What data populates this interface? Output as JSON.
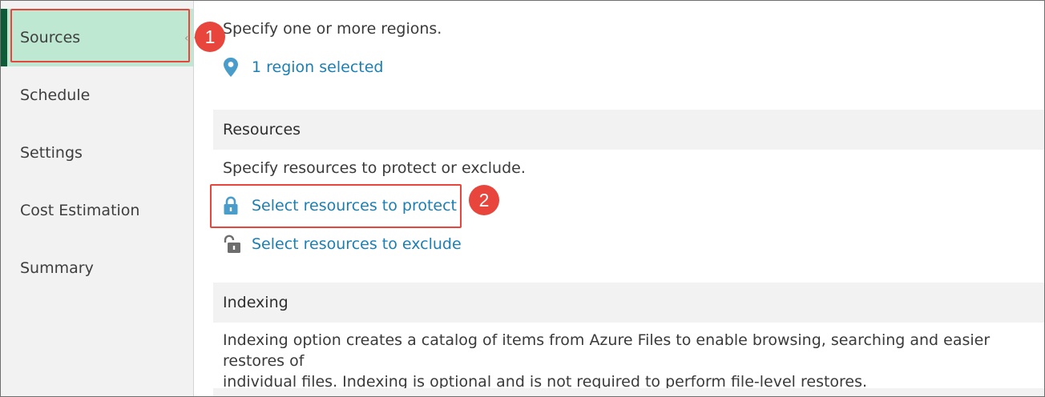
{
  "sidebar": {
    "items": [
      {
        "label": "Sources",
        "active": true
      },
      {
        "label": "Schedule"
      },
      {
        "label": "Settings"
      },
      {
        "label": "Cost Estimation"
      },
      {
        "label": "Summary"
      }
    ]
  },
  "regions": {
    "description": "Specify one or more regions.",
    "link_label": "1 region selected",
    "icon": "location-pin-icon"
  },
  "resources": {
    "header": "Resources",
    "description": "Specify resources to protect or exclude.",
    "protect_label": "Select resources to protect",
    "protect_icon": "lock-closed-icon",
    "exclude_label": "Select resources to exclude",
    "exclude_icon": "lock-open-icon"
  },
  "indexing": {
    "header": "Indexing",
    "description_line1": "Indexing option creates a catalog of items from Azure Files to enable browsing, searching and easier restores of",
    "description_line2": "individual files. Indexing is optional and is not required to perform file-level restores."
  },
  "callouts": [
    {
      "number": "1"
    },
    {
      "number": "2"
    }
  ],
  "colors": {
    "accent": "#0d5c37",
    "active_bg": "#bfe8d3",
    "link": "#1b7fb5",
    "callout": "#e8453c"
  }
}
